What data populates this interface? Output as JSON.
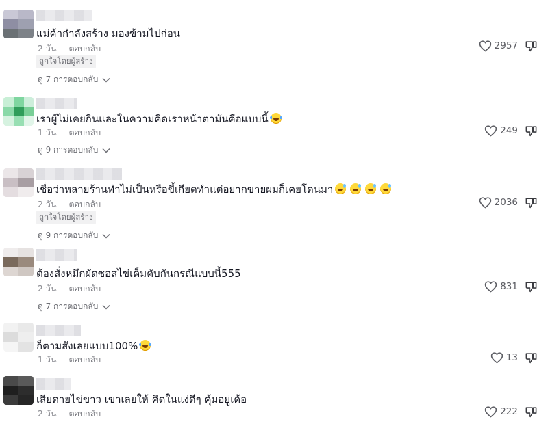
{
  "comments": [
    {
      "text": "แม่ค้ากำลังสร้าง มองข้ามไปก่อน",
      "date": "2 วัน",
      "reply": "ตอบกลับ",
      "creator_badge": "ถูกใจโดยผู้สร้าง",
      "view_replies": "ดู 7 การตอบกลับ",
      "likes": "2957",
      "emojis": []
    },
    {
      "text": "เราผู้ไม่เคยกินและในความคิดเราหน้าตามันคือแบบนี้",
      "date": "1 วัน",
      "reply": "ตอบกลับ",
      "creator_badge": "",
      "view_replies": "ดู 9 การตอบกลับ",
      "likes": "249",
      "emojis": [
        "face-with-tears-of-joy"
      ]
    },
    {
      "text": "เชื่อว่าหลายร้านทำไม่เป็นหรือขี้เกียดทำแต่อยากขายผมก็เคยโดนมา",
      "date": "2 วัน",
      "reply": "ตอบกลับ",
      "creator_badge": "ถูกใจโดยผู้สร้าง",
      "view_replies": "ดู 9 การตอบกลับ",
      "likes": "2036",
      "emojis": [
        "grinning-face-with-sweat",
        "grinning-face-with-sweat",
        "grinning-face-with-sweat",
        "grinning-face-with-sweat"
      ]
    },
    {
      "text": "ต้องสั่งหมึกผัดซอสไข่เค็มคับกันกรณีแบบนี้555",
      "date": "2 วัน",
      "reply": "ตอบกลับ",
      "creator_badge": "",
      "view_replies": "ดู 7 การตอบกลับ",
      "likes": "831",
      "emojis": []
    },
    {
      "text": "ก็ตามสังเลยแบบ100%",
      "date": "1 วัน",
      "reply": "ตอบกลับ",
      "creator_badge": "",
      "view_replies": "",
      "likes": "13",
      "emojis": [
        "face-with-tears-of-joy"
      ]
    },
    {
      "text": "เสียดายไข่ขาว เขาเลยให้ คิดในแง่ดีๆ คุ้มอยู่เด้อ",
      "date": "2 วัน",
      "reply": "ตอบกลับ",
      "creator_badge": "",
      "view_replies": "",
      "likes": "222",
      "emojis": []
    }
  ],
  "icons": {
    "like": "heart-outline-icon",
    "dislike": "thumbs-down-icon",
    "expand": "chevron-down-icon"
  },
  "colors": {
    "text": "#161823",
    "muted": "#8a8b91",
    "badge_bg": "#f1f1f2"
  }
}
